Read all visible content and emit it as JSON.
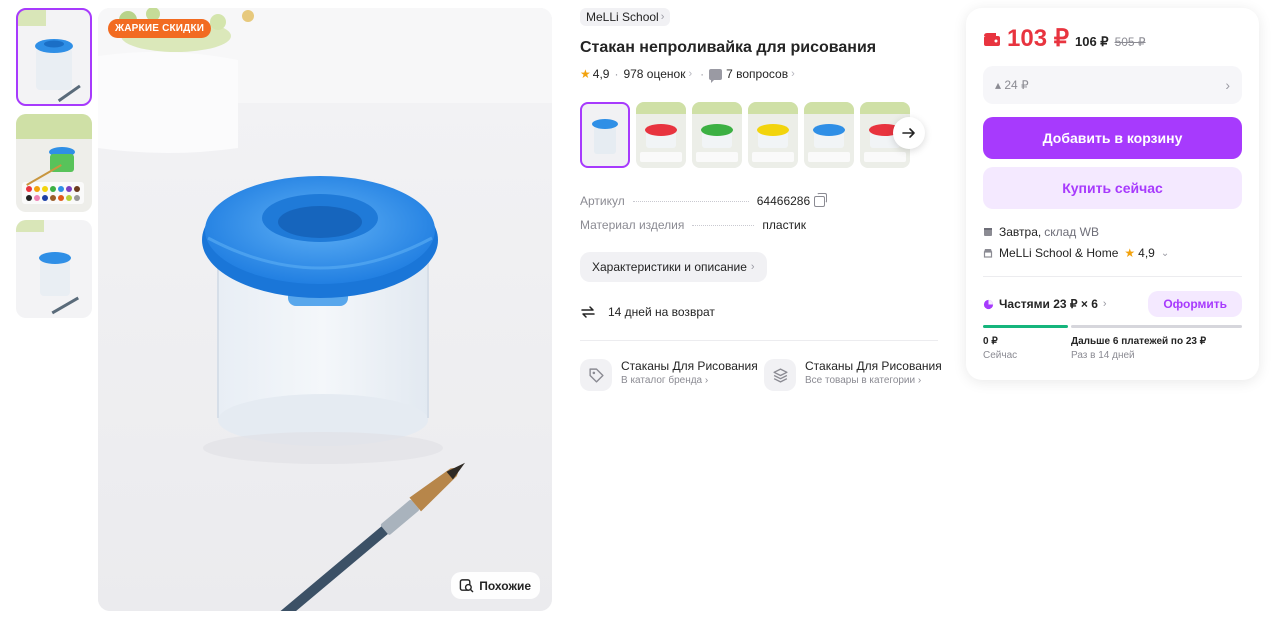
{
  "gallery_left": {
    "thumbs": [
      "product-photo-blue-cup",
      "product-photo-paints",
      "product-photo-blue-cup-brush"
    ]
  },
  "main_image": {
    "badge": "ЖАРКИЕ СКИДКИ",
    "similar_label": "Похожие"
  },
  "product": {
    "brand": "MeLLi School",
    "title": "Стакан непроливайка для рисования",
    "rating": "4,9",
    "reviews": "978 оценок",
    "questions": "7 вопросов",
    "gallery": [
      "blue",
      "red",
      "green",
      "yellow",
      "blue",
      "red"
    ]
  },
  "specs": [
    {
      "key": "Артикул",
      "value": "64466286"
    },
    {
      "key": "Материал изделия",
      "value": "пластик"
    }
  ],
  "characteristics_button": "Характеристики и описание",
  "return_text": "14 дней на возврат",
  "catalog_links": [
    {
      "title": "Стаканы Для Рисования",
      "subtitle": "В каталог бренда"
    },
    {
      "title": "Стаканы Для Рисования",
      "subtitle": "Все товары в категории"
    }
  ],
  "price_card": {
    "price_wallet": "103 ₽",
    "price": "106 ₽",
    "old_price": "505 ₽",
    "discount_hint": "▴ 24 ₽",
    "add_to_cart": "Добавить в корзину",
    "buy_now": "Купить сейчас",
    "delivery_day": "Завтра,",
    "delivery_where": "склад WB",
    "seller_name": "MeLLi School & Home",
    "seller_rating": "4,9",
    "installment_label": "Частями 23 ₽ × 6",
    "installment_button": "Оформить",
    "now_amount": "0 ₽",
    "now_label": "Сейчас",
    "later_amount": "Дальше 6 платежей по 23 ₽",
    "later_label": "Раз в 14 дней"
  },
  "colors": {
    "accent": "#a73afd",
    "price": "#e8343f",
    "promo": "#f26b21",
    "progress_done": "#15b57c"
  }
}
